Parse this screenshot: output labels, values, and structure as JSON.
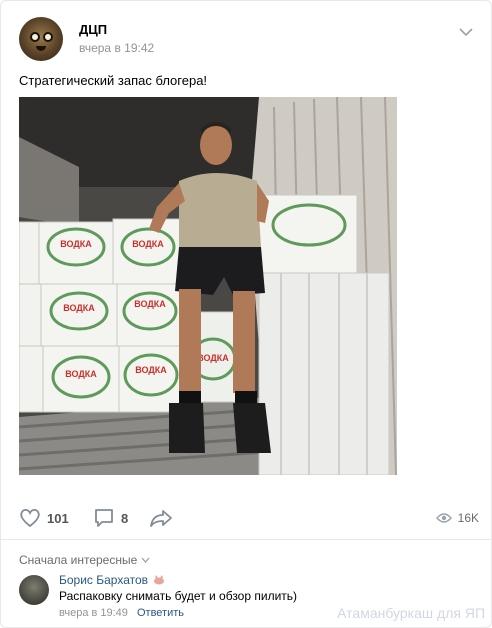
{
  "post": {
    "author": "ДЦП",
    "time": "вчера в 19:42",
    "text": "Стратегический запас блогера!",
    "box_label": "ВОДКА"
  },
  "actions": {
    "likes": "101",
    "comments": "8",
    "views": "16K"
  },
  "comments_section": {
    "sort_label": "Сначала интересные",
    "items": [
      {
        "author": "Борис Бархатов",
        "text": "Распаковку снимать будет и обзор пилить)",
        "time": "вчера в 19:49",
        "reply_label": "Ответить"
      }
    ]
  },
  "watermark": "Атаманбуркаш для ЯП",
  "colors": {
    "link": "#2a5885",
    "muted": "#939393",
    "border": "#e7e8ec"
  }
}
